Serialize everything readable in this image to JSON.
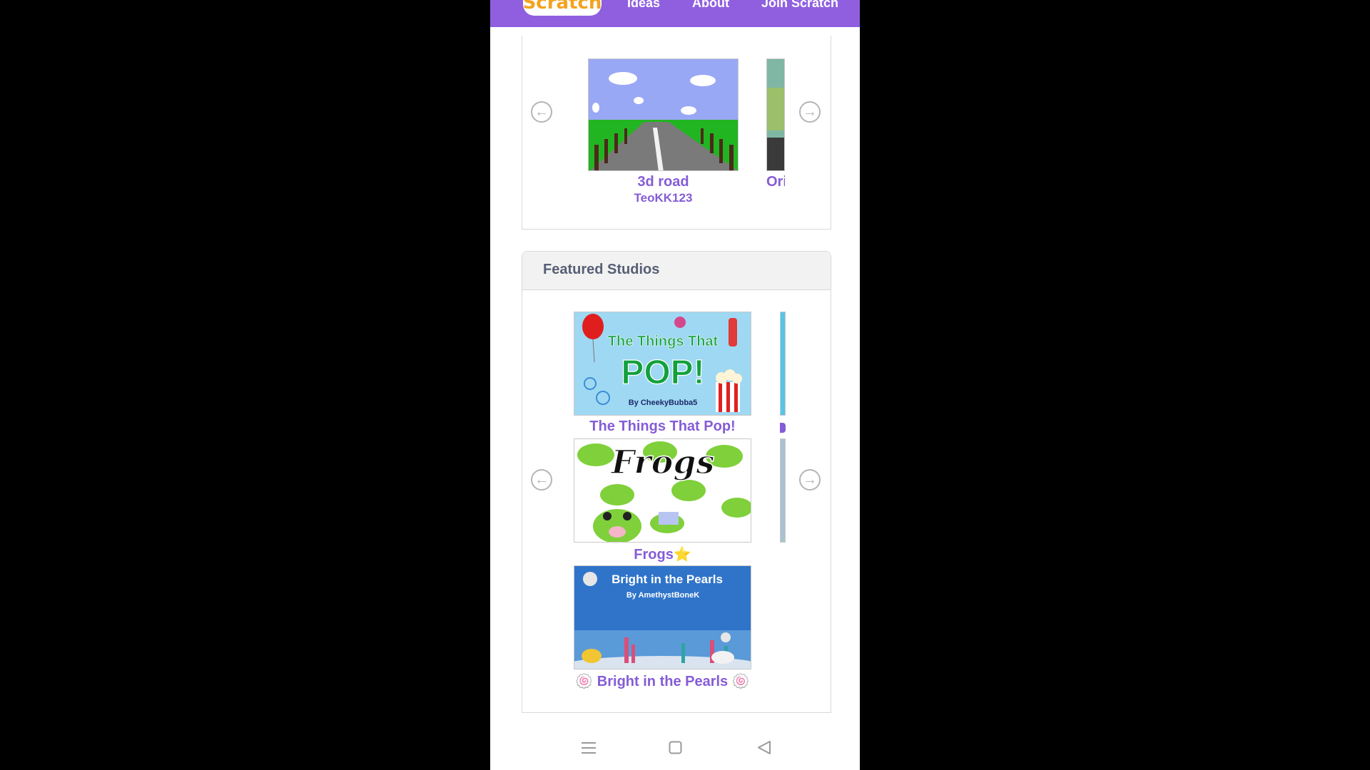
{
  "header": {
    "logo_text": "Scratch",
    "nav": [
      "Ideas",
      "About",
      "Join Scratch"
    ],
    "bg_color": "#8f5fe0"
  },
  "featured_projects": {
    "items": [
      {
        "title": "3d road",
        "author": "TeoKK123"
      },
      {
        "title": "Ori",
        "author": ""
      }
    ],
    "prev_icon": "arrow-left-circle-icon",
    "next_icon": "arrow-right-circle-icon"
  },
  "featured_studios": {
    "heading": "Featured Studios",
    "items": [
      {
        "title": "The Things That Pop!",
        "thumb_title_line1": "The Things That",
        "thumb_title_line2": "POP!",
        "thumb_byline": "By CheekyBubba5"
      },
      {
        "title": "Frogs⭐",
        "thumb_title": "Frogs"
      },
      {
        "title": "🍥 Bright in the Pearls 🍥",
        "thumb_title": "Bright in the Pearls",
        "thumb_byline": "By AmethystBoneK"
      }
    ]
  },
  "android_nav": {
    "menu_icon": "menu-icon",
    "home_icon": "home-square-icon",
    "back_icon": "back-triangle-icon"
  },
  "colors": {
    "accent": "#855cd6",
    "heading": "#575e75"
  }
}
